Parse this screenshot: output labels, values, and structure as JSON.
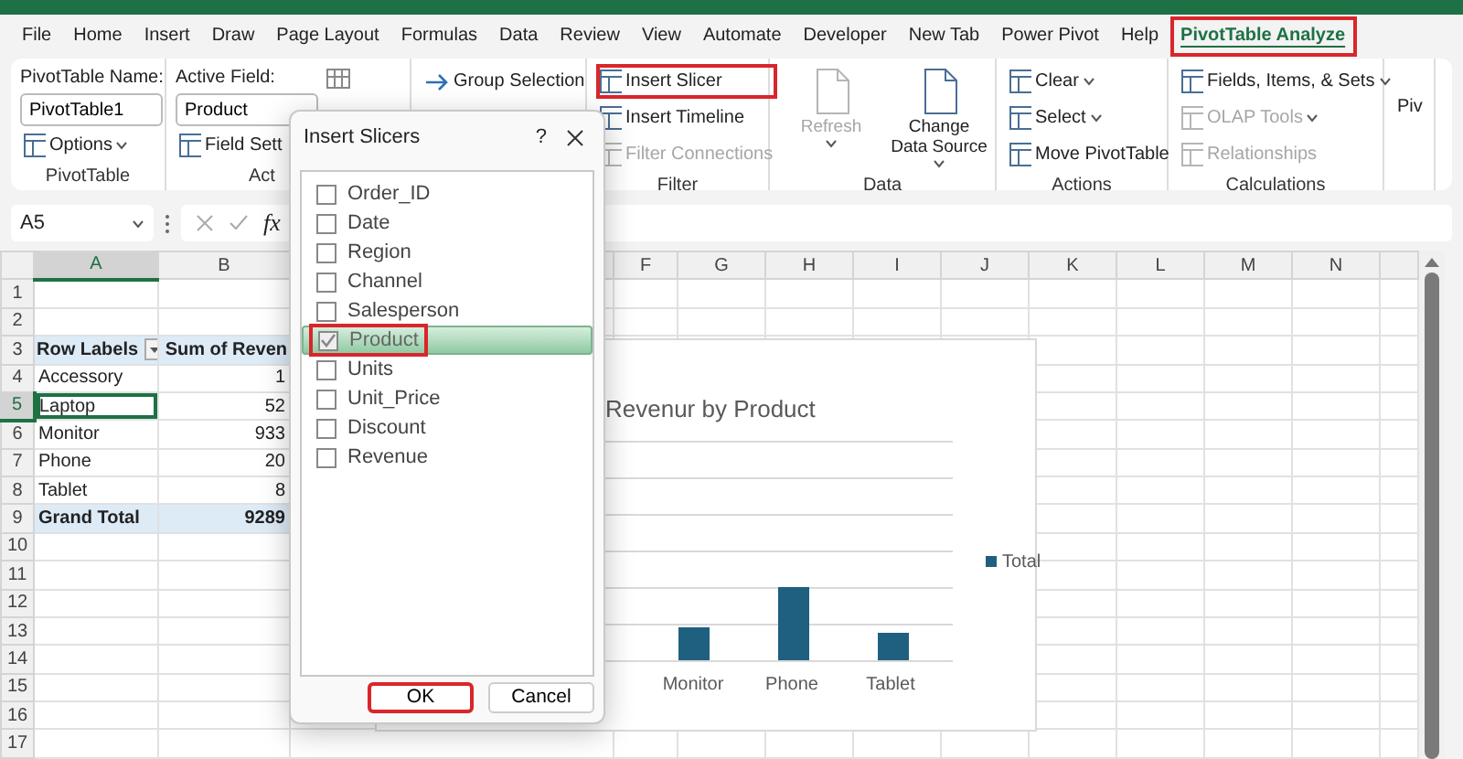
{
  "menu_tabs": [
    {
      "label": "File",
      "selected": false,
      "highlighted": false
    },
    {
      "label": "Home",
      "selected": false,
      "highlighted": false
    },
    {
      "label": "Insert",
      "selected": false,
      "highlighted": false
    },
    {
      "label": "Draw",
      "selected": false,
      "highlighted": false
    },
    {
      "label": "Page Layout",
      "selected": false,
      "highlighted": false
    },
    {
      "label": "Formulas",
      "selected": false,
      "highlighted": false
    },
    {
      "label": "Data",
      "selected": false,
      "highlighted": false
    },
    {
      "label": "Review",
      "selected": false,
      "highlighted": false
    },
    {
      "label": "View",
      "selected": false,
      "highlighted": false
    },
    {
      "label": "Automate",
      "selected": false,
      "highlighted": false
    },
    {
      "label": "Developer",
      "selected": false,
      "highlighted": false
    },
    {
      "label": "New Tab",
      "selected": false,
      "highlighted": false
    },
    {
      "label": "Power Pivot",
      "selected": false,
      "highlighted": false
    },
    {
      "label": "Help",
      "selected": false,
      "highlighted": false
    },
    {
      "label": "PivotTable Analyze",
      "selected": true,
      "highlighted": true
    }
  ],
  "ribbon": {
    "groups": [
      {
        "label": "PivotTable",
        "field_label": "PivotTable Name:",
        "field_value": "PivotTable1",
        "items": [
          {
            "label": "Options",
            "kind": "small",
            "disabled": false,
            "dropdown": true,
            "highlighted": false
          }
        ]
      },
      {
        "label": "Act",
        "field_label": "Active Field:",
        "field_value": "Product",
        "items": [
          {
            "label": "Field Sett",
            "kind": "small",
            "disabled": false,
            "dropdown": false,
            "highlighted": false
          }
        ]
      },
      {
        "items": [
          {
            "label": "Group Selection",
            "kind": "small",
            "disabled": false,
            "dropdown": false,
            "highlighted": false
          }
        ]
      },
      {
        "label": "Filter",
        "items": [
          {
            "label": "Insert Slicer",
            "kind": "small",
            "disabled": false,
            "dropdown": false,
            "highlighted": true
          },
          {
            "label": "Insert Timeline",
            "kind": "small",
            "disabled": false,
            "dropdown": false,
            "highlighted": false
          },
          {
            "label": "Filter Connections",
            "kind": "small",
            "disabled": true,
            "dropdown": false,
            "highlighted": false
          }
        ]
      },
      {
        "label": "Data",
        "items": [
          {
            "label": "Refresh",
            "kind": "large",
            "disabled": true,
            "dropdown": true,
            "highlighted": false
          },
          {
            "label": "Change Data Source",
            "kind": "large",
            "disabled": false,
            "dropdown": true,
            "highlighted": false
          }
        ]
      },
      {
        "label": "Actions",
        "items": [
          {
            "label": "Clear",
            "kind": "small",
            "disabled": false,
            "dropdown": true,
            "highlighted": false
          },
          {
            "label": "Select",
            "kind": "small",
            "disabled": false,
            "dropdown": true,
            "highlighted": false
          },
          {
            "label": "Move PivotTable",
            "kind": "small",
            "disabled": false,
            "dropdown": false,
            "highlighted": false
          }
        ]
      },
      {
        "label": "Calculations",
        "items": [
          {
            "label": "Fields, Items, & Sets",
            "kind": "small",
            "disabled": false,
            "dropdown": true,
            "highlighted": false
          },
          {
            "label": "OLAP Tools",
            "kind": "small",
            "disabled": true,
            "dropdown": true,
            "highlighted": false
          },
          {
            "label": "Relationships",
            "kind": "small",
            "disabled": true,
            "dropdown": false,
            "highlighted": false
          }
        ]
      },
      {
        "items": [
          {
            "label": "Piv",
            "kind": "plain",
            "disabled": false,
            "dropdown": false,
            "highlighted": false
          }
        ]
      }
    ]
  },
  "formula_bar": {
    "name_box": "A5",
    "function_label": "fx"
  },
  "sheet": {
    "columns": [
      {
        "label": "A",
        "selected": true
      },
      {
        "label": "B",
        "selected": false
      },
      {
        "label": "F",
        "selected": false
      },
      {
        "label": "G",
        "selected": false
      },
      {
        "label": "H",
        "selected": false
      },
      {
        "label": "I",
        "selected": false
      },
      {
        "label": "J",
        "selected": false
      },
      {
        "label": "K",
        "selected": false
      },
      {
        "label": "L",
        "selected": false
      },
      {
        "label": "M",
        "selected": false
      },
      {
        "label": "N",
        "selected": false
      }
    ],
    "rows": [
      {
        "number": "1",
        "selected": false
      },
      {
        "number": "2",
        "selected": false
      },
      {
        "number": "3",
        "selected": false,
        "cells": [
          {
            "text": "Row Labels",
            "kind": "header",
            "filter": true,
            "selected": false
          },
          {
            "text": "Sum of Reven",
            "kind": "header",
            "filter": false,
            "selected": false
          }
        ]
      },
      {
        "number": "4",
        "selected": false,
        "cells": [
          {
            "text": "Accessory",
            "kind": "item",
            "filter": false,
            "selected": false
          },
          {
            "text": "1",
            "kind": "item",
            "filter": false,
            "selected": false
          }
        ]
      },
      {
        "number": "5",
        "selected": true,
        "cells": [
          {
            "text": "Laptop",
            "kind": "item",
            "filter": false,
            "selected": true
          },
          {
            "text": "52",
            "kind": "item",
            "filter": false,
            "selected": false
          }
        ]
      },
      {
        "number": "6",
        "selected": false,
        "cells": [
          {
            "text": "Monitor",
            "kind": "item",
            "filter": false,
            "selected": false
          },
          {
            "text": "933",
            "kind": "item",
            "filter": false,
            "selected": false
          }
        ]
      },
      {
        "number": "7",
        "selected": false,
        "cells": [
          {
            "text": "Phone",
            "kind": "item",
            "filter": false,
            "selected": false
          },
          {
            "text": "20",
            "kind": "item",
            "filter": false,
            "selected": false
          }
        ]
      },
      {
        "number": "8",
        "selected": false,
        "cells": [
          {
            "text": "Tablet",
            "kind": "item",
            "filter": false,
            "selected": false
          },
          {
            "text": "8",
            "kind": "item",
            "filter": false,
            "selected": false
          }
        ]
      },
      {
        "number": "9",
        "selected": false,
        "cells": [
          {
            "text": "Grand Total",
            "kind": "total",
            "filter": false,
            "selected": false
          },
          {
            "text": "9289",
            "kind": "total",
            "filter": false,
            "selected": false
          }
        ]
      },
      {
        "number": "10",
        "selected": false
      },
      {
        "number": "11",
        "selected": false
      },
      {
        "number": "12",
        "selected": false
      },
      {
        "number": "13",
        "selected": false
      },
      {
        "number": "14",
        "selected": false
      },
      {
        "number": "15",
        "selected": false
      },
      {
        "number": "16",
        "selected": false
      },
      {
        "number": "17",
        "selected": false
      }
    ]
  },
  "chart": {
    "title": "Revenur by Product",
    "categories": [
      "Monitor",
      "Phone",
      "Tablet"
    ],
    "legend": "Total"
  },
  "dialog": {
    "title": "Insert Slicers",
    "help": "?",
    "fields": [
      {
        "label": "Order_ID",
        "checked": false,
        "selected": false,
        "highlighted": false
      },
      {
        "label": "Date",
        "checked": false,
        "selected": false,
        "highlighted": false
      },
      {
        "label": "Region",
        "checked": false,
        "selected": false,
        "highlighted": false
      },
      {
        "label": "Channel",
        "checked": false,
        "selected": false,
        "highlighted": false
      },
      {
        "label": "Salesperson",
        "checked": false,
        "selected": false,
        "highlighted": false
      },
      {
        "label": "Product",
        "checked": true,
        "selected": true,
        "highlighted": true
      },
      {
        "label": "Units",
        "checked": false,
        "selected": false,
        "highlighted": false
      },
      {
        "label": "Unit_Price",
        "checked": false,
        "selected": false,
        "highlighted": false
      },
      {
        "label": "Discount",
        "checked": false,
        "selected": false,
        "highlighted": false
      },
      {
        "label": "Revenue",
        "checked": false,
        "selected": false,
        "highlighted": false
      }
    ],
    "buttons": [
      {
        "label": "OK",
        "highlighted": true
      },
      {
        "label": "Cancel",
        "highlighted": false
      }
    ]
  }
}
